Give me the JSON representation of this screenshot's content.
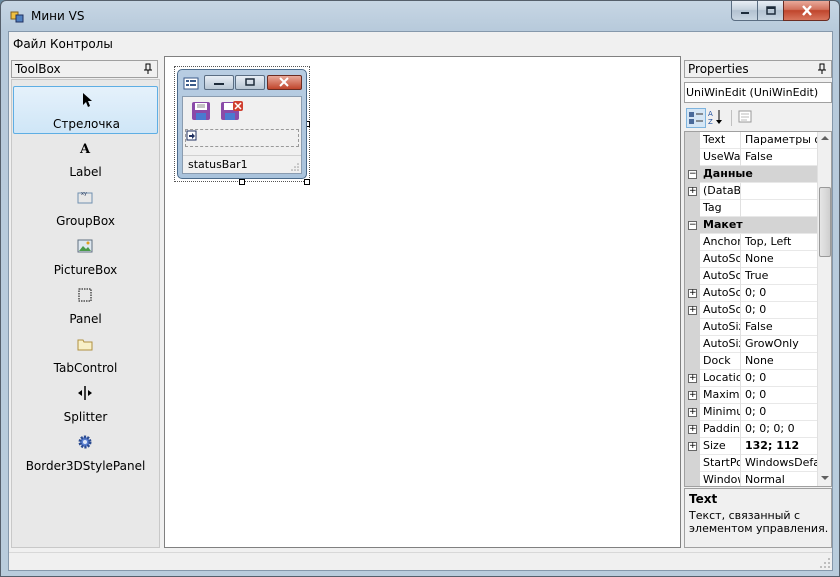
{
  "window": {
    "title": "Мини VS"
  },
  "menu": {
    "items": [
      "Файл",
      "Контролы"
    ]
  },
  "toolbox": {
    "title": "ToolBox",
    "items": [
      {
        "label": "Стрелочка",
        "icon": "pointer-icon",
        "selected": true
      },
      {
        "label": "Label",
        "icon": "label-icon"
      },
      {
        "label": "GroupBox",
        "icon": "groupbox-icon"
      },
      {
        "label": "PictureBox",
        "icon": "picturebox-icon"
      },
      {
        "label": "Panel",
        "icon": "panel-icon"
      },
      {
        "label": "TabControl",
        "icon": "tabcontrol-icon"
      },
      {
        "label": "Splitter",
        "icon": "splitter-icon"
      },
      {
        "label": "Border3DStylePanel",
        "icon": "gear-icon"
      }
    ]
  },
  "designer": {
    "status_label": "statusBar1"
  },
  "properties": {
    "title": "Properties",
    "object": "UniWinEdit (UniWinEdit)",
    "rows": [
      {
        "kind": "prop",
        "name": "Text",
        "value": "Параметры or"
      },
      {
        "kind": "prop",
        "name": "UseWai",
        "value": "False"
      },
      {
        "kind": "cat",
        "name": "Данные"
      },
      {
        "kind": "prop",
        "name": "(DataBi",
        "value": "",
        "expand": true
      },
      {
        "kind": "prop",
        "name": "Tag",
        "value": ""
      },
      {
        "kind": "cat",
        "name": "Макет"
      },
      {
        "kind": "prop",
        "name": "Anchor",
        "value": "Top, Left"
      },
      {
        "kind": "prop",
        "name": "AutoSca",
        "value": "None"
      },
      {
        "kind": "prop",
        "name": "AutoScr",
        "value": "True"
      },
      {
        "kind": "prop",
        "name": "AutoScr",
        "value": "0; 0",
        "expand": true
      },
      {
        "kind": "prop",
        "name": "AutoScr",
        "value": "0; 0",
        "expand": true
      },
      {
        "kind": "prop",
        "name": "AutoSiz",
        "value": "False"
      },
      {
        "kind": "prop",
        "name": "AutoSiz",
        "value": "GrowOnly"
      },
      {
        "kind": "prop",
        "name": "Dock",
        "value": "None"
      },
      {
        "kind": "prop",
        "name": "Locatio",
        "value": "0; 0",
        "expand": true
      },
      {
        "kind": "prop",
        "name": "Maximu",
        "value": "0; 0",
        "expand": true
      },
      {
        "kind": "prop",
        "name": "Minimur",
        "value": "0; 0",
        "expand": true
      },
      {
        "kind": "prop",
        "name": "Padding",
        "value": "0; 0; 0; 0",
        "expand": true
      },
      {
        "kind": "prop",
        "name": "Size",
        "value": "132; 112",
        "expand": true,
        "bold": true
      },
      {
        "kind": "prop",
        "name": "StartPo",
        "value": "WindowsDefau"
      },
      {
        "kind": "prop",
        "name": "Window",
        "value": "Normal"
      }
    ],
    "description": {
      "title": "Text",
      "text": "Текст, связанный с элементом управления."
    }
  }
}
